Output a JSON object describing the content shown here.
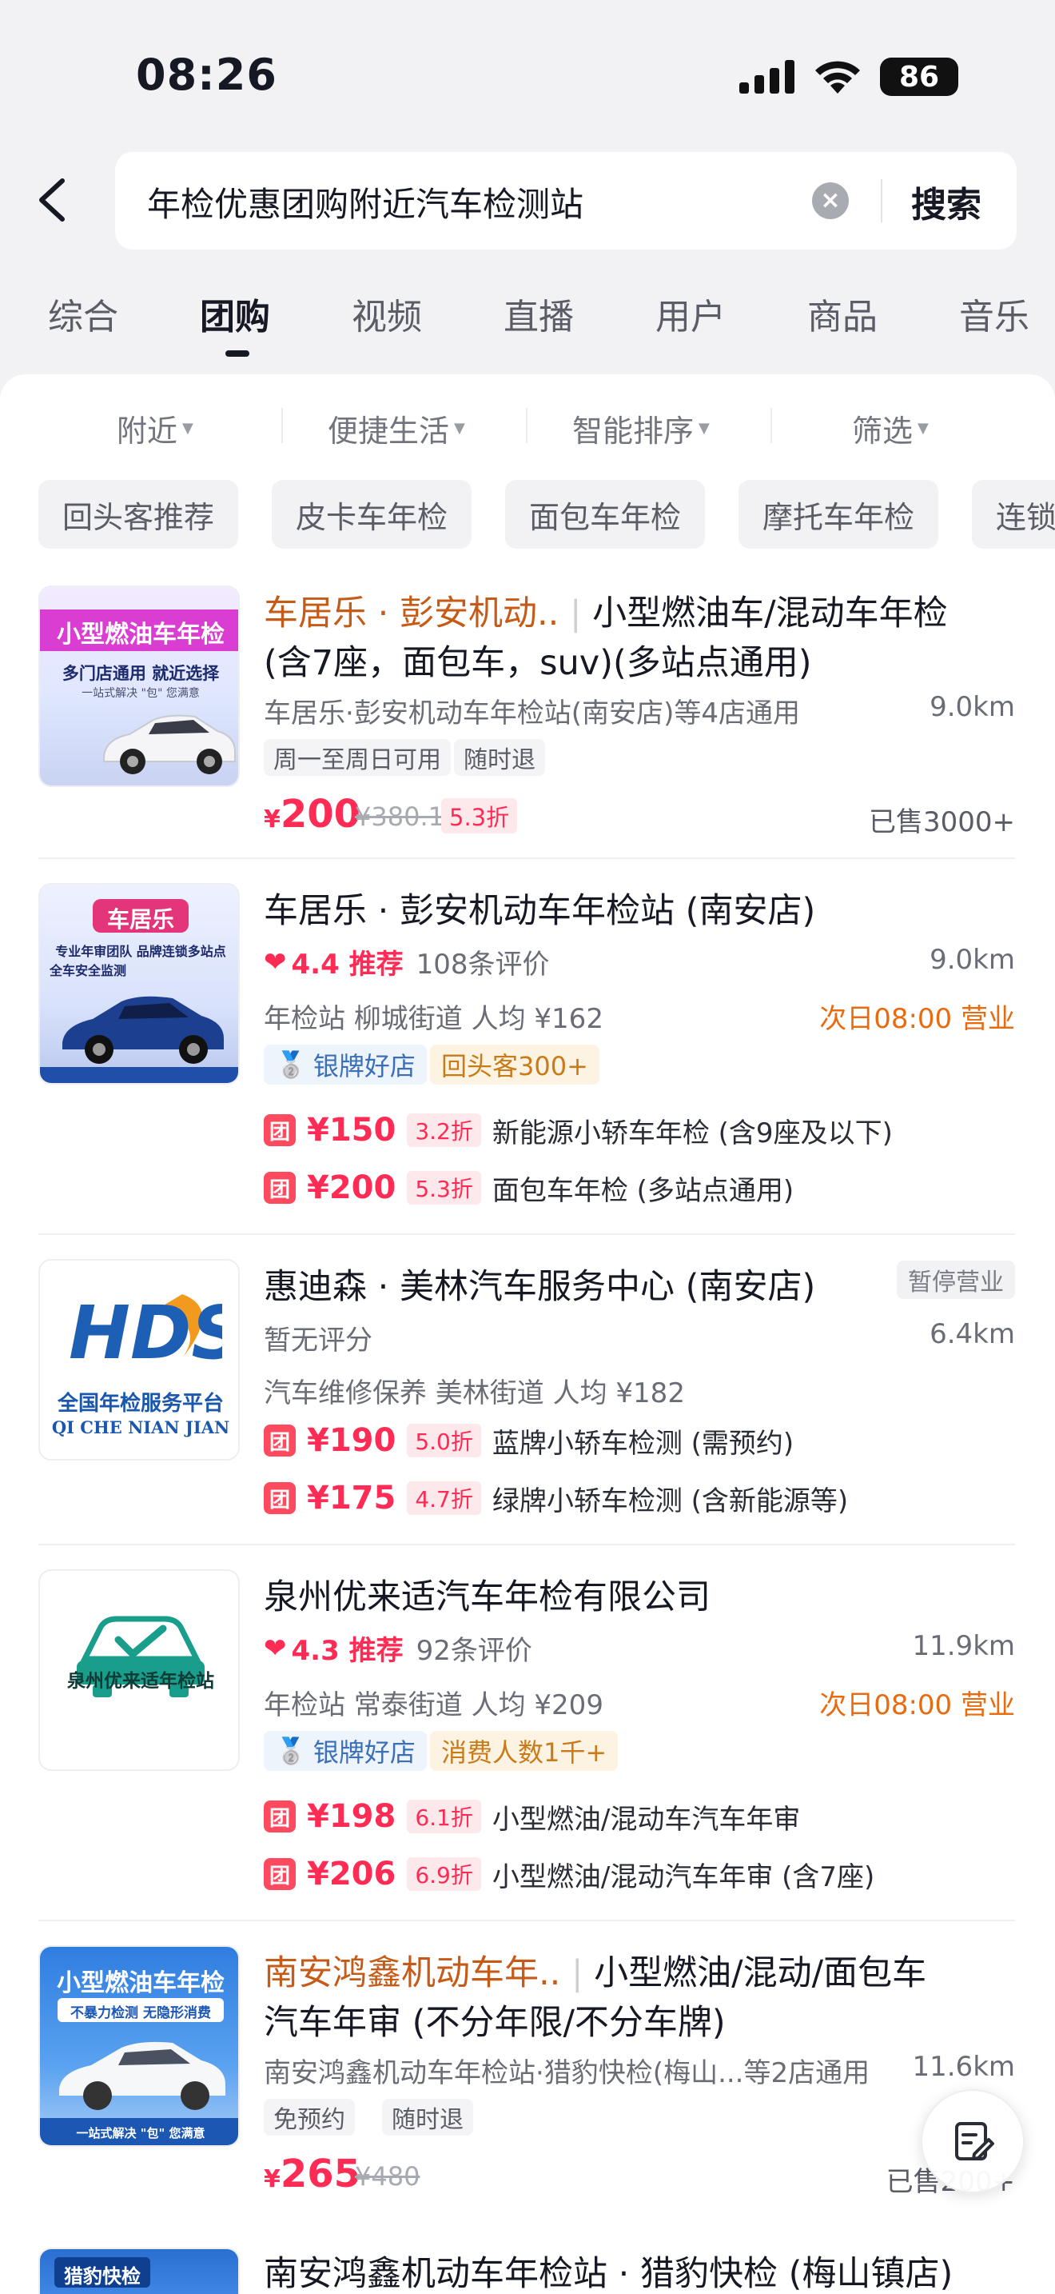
{
  "status_bar": {
    "time": "08:26",
    "battery": "86"
  },
  "search": {
    "query": "年检优惠团购附近汽车检测站",
    "button": "搜索"
  },
  "tabs": [
    "综合",
    "团购",
    "视频",
    "直播",
    "用户",
    "商品",
    "音乐"
  ],
  "active_tab": "团购",
  "filters": [
    "附近",
    "便捷生活",
    "智能排序",
    "筛选"
  ],
  "chips": [
    "回头客推荐",
    "皮卡车年检",
    "面包车年检",
    "摩托车年检",
    "连锁"
  ],
  "results": [
    {
      "thumb_title": "小型燃油车年检",
      "thumb_sub1": "多门店通用 就近选择",
      "thumb_sub2": "一站式解决 \"包\" 您满意",
      "title_prefix": "车居乐 · 彭安机动..",
      "title_line1": "小型燃油车/混动车年检",
      "title_line2": "(含7座，面包车，suv)(多站点通用)",
      "stores": "车居乐·彭安机动车年检站(南安店)等4店通用",
      "distance": "9.0km",
      "tags": [
        "周一至周日可用",
        "随时退"
      ],
      "price_symbol": "¥",
      "price": "200",
      "original": "¥380.1",
      "discount": "5.3折",
      "sold": "已售3000+"
    },
    {
      "thumb_title": "车居乐",
      "thumb_sub1": "专业年审团队  品牌连锁多站点",
      "thumb_sub2": "全车安全监测",
      "name": "车居乐 · 彭安机动车年检站 (南安店)",
      "rating": "4.4 推荐",
      "reviews": "108条评价",
      "distance": "9.0km",
      "info": "年检站  柳城街道  人均 ¥162",
      "open": "次日08:00 营业",
      "badge": "银牌好店",
      "badge2": "回头客300+",
      "deals": [
        {
          "price": "¥150",
          "discount": "3.2折",
          "name": "新能源小轿车年检 (含9座及以下)"
        },
        {
          "price": "¥200",
          "discount": "5.3折",
          "name": "面包车年检 (多站点通用)"
        }
      ]
    },
    {
      "thumb_logo": "HDS",
      "thumb_sub1": "全国年检服务平台",
      "thumb_sub2": "QI CHE NIAN JIAN",
      "name": "惠迪森 · 美林汽车服务中心 (南安店)",
      "status": "暂停营业",
      "rating_none": "暂无评分",
      "distance": "6.4km",
      "info": "汽车维修保养  美林街道  人均 ¥182",
      "deals": [
        {
          "price": "¥190",
          "discount": "5.0折",
          "name": "蓝牌小轿车检测 (需预约)"
        },
        {
          "price": "¥175",
          "discount": "4.7折",
          "name": "绿牌小轿车检测 (含新能源等)"
        }
      ]
    },
    {
      "thumb_title": "泉州优来适年检站",
      "name": "泉州优来适汽车年检有限公司",
      "rating": "4.3 推荐",
      "reviews": "92条评价",
      "distance": "11.9km",
      "info": "年检站  常泰街道  人均 ¥209",
      "open": "次日08:00 营业",
      "badge": "银牌好店",
      "badge2": "消费人数1千+",
      "deals": [
        {
          "price": "¥198",
          "discount": "6.1折",
          "name": "小型燃油/混动车汽车年审"
        },
        {
          "price": "¥206",
          "discount": "6.9折",
          "name": "小型燃油/混动汽车年审 (含7座)"
        }
      ]
    },
    {
      "thumb_title": "小型燃油车年检",
      "thumb_sub1": "不暴力检测 无隐形消费",
      "thumb_sub2": "一站式解决 \"包\" 您满意",
      "title_prefix": "南安鸿鑫机动车年..",
      "title_line1": "小型燃油/混动/面包车",
      "title_line2": "汽车年审 (不分年限/不分车牌)",
      "stores": "南安鸿鑫机动车年检站·猎豹快检(梅山...等2店通用",
      "distance": "11.6km",
      "tags": [
        "免预约",
        "随时退"
      ],
      "price_symbol": "¥",
      "price": "265",
      "original": "¥480",
      "sold": "已售200+"
    },
    {
      "thumb_title": "猎豹快检",
      "name": "南安鸿鑫机动车年检站 · 猎豹快检 (梅山镇店)"
    }
  ],
  "colors": {
    "accent": "#fe2c55",
    "orange": "#c65a17",
    "open": "#e86b10"
  }
}
